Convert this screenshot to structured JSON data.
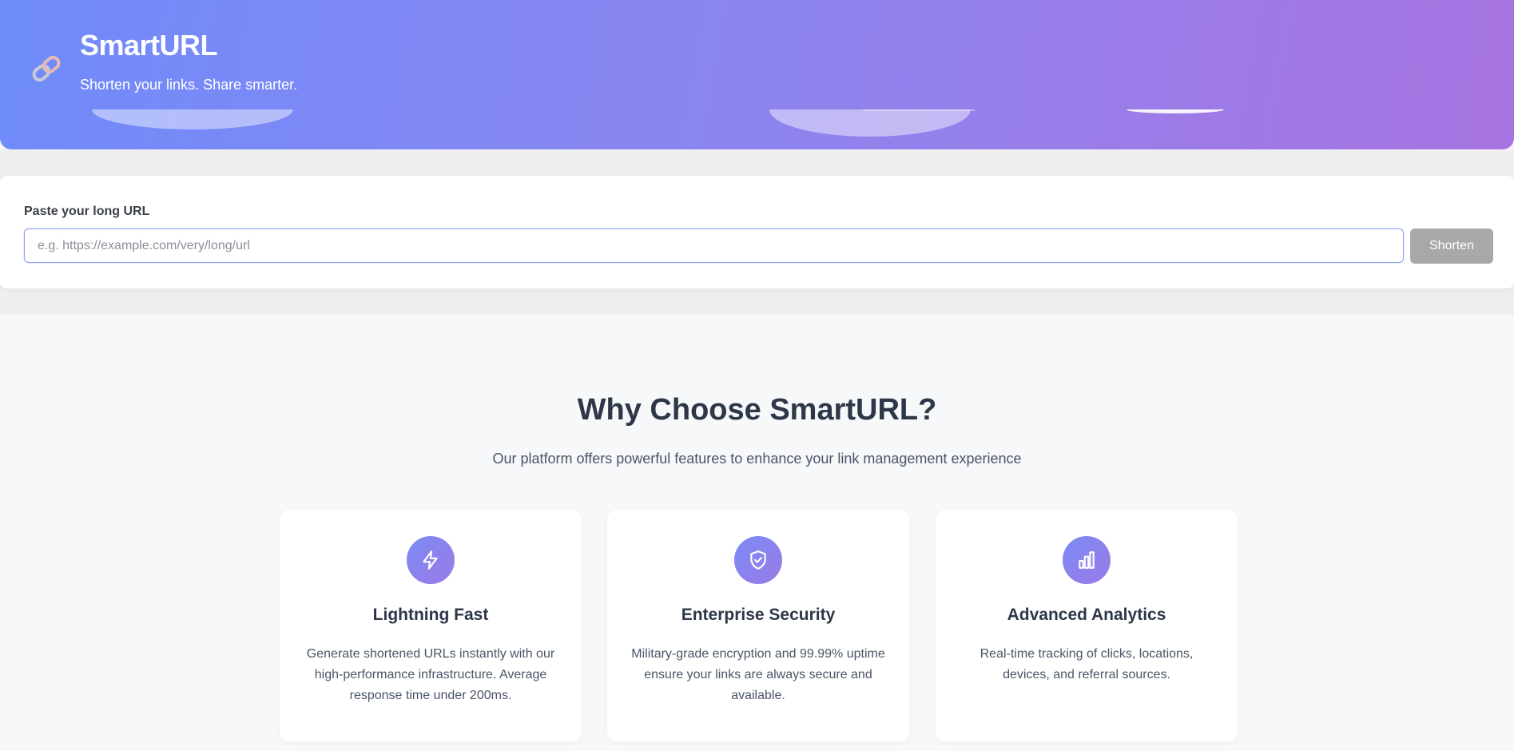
{
  "header": {
    "title": "SmartURL",
    "tagline": "Shorten your links. Share smarter.",
    "logo_icon": "link-icon"
  },
  "shortener": {
    "label": "Paste your long URL",
    "input_value": "",
    "input_placeholder": "e.g. https://example.com/very/long/url",
    "button_label": "Shorten"
  },
  "features": {
    "title": "Why Choose SmartURL?",
    "subtitle": "Our platform offers powerful features to enhance your link management experience",
    "cards": [
      {
        "icon": "lightning-icon",
        "title": "Lightning Fast",
        "description": "Generate shortened URLs instantly with our high-performance infrastructure. Average response time under 200ms."
      },
      {
        "icon": "shield-check-icon",
        "title": "Enterprise Security",
        "description": "Military-grade encryption and 99.99% uptime ensure your links are always secure and available."
      },
      {
        "icon": "bar-chart-icon",
        "title": "Advanced Analytics",
        "description": "Real-time tracking of clicks, locations, devices, and referral sources."
      }
    ]
  },
  "colors": {
    "header_gradient_start": "#6f8bfa",
    "header_gradient_end": "#a673e0",
    "button_disabled": "#a8a8a8",
    "icon_gradient_start": "#7b8bf5",
    "icon_gradient_end": "#9a7ae6"
  }
}
